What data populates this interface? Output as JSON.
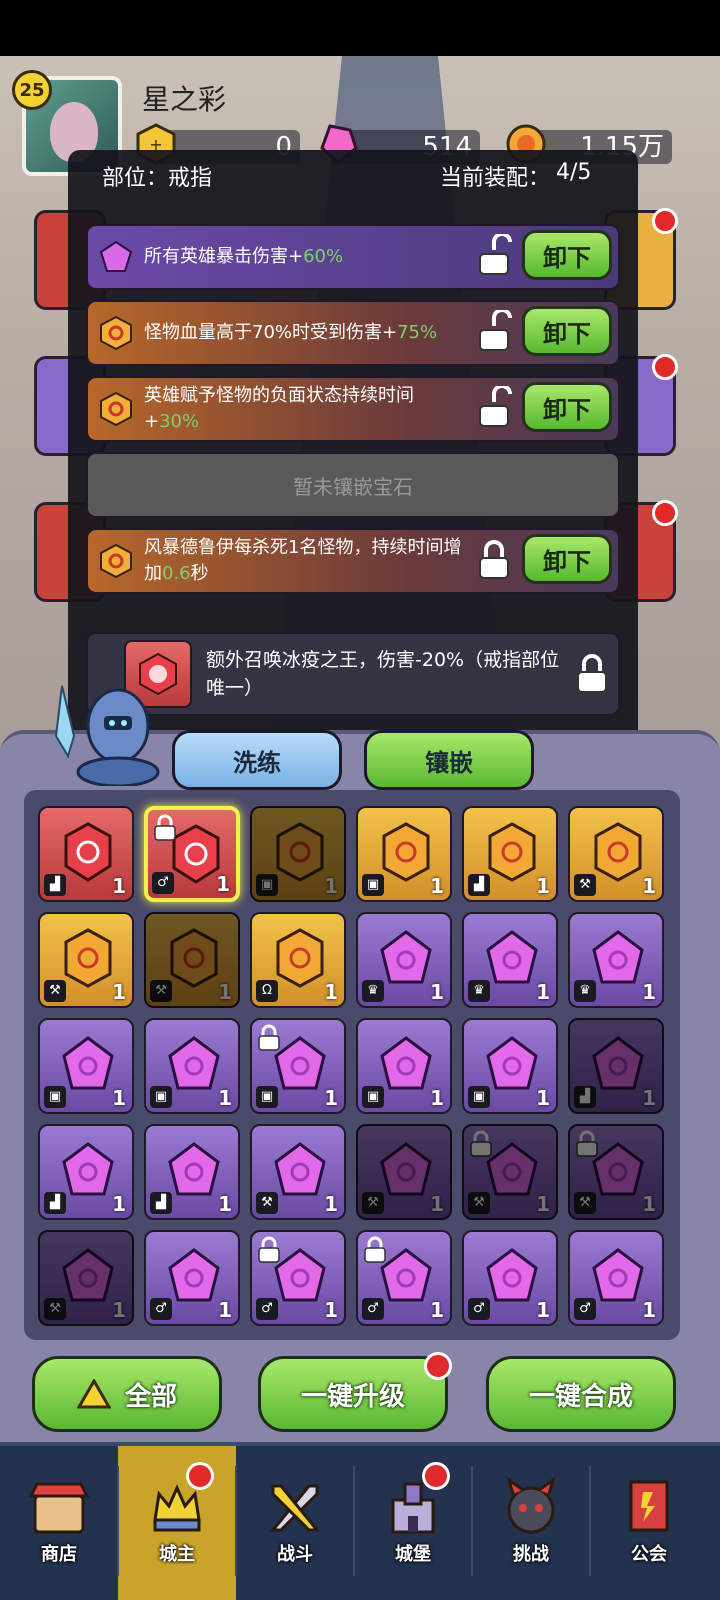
{
  "player": {
    "level": "25",
    "name": "星之彩"
  },
  "currencies": [
    {
      "name": "gold-coin-icon",
      "value": "0"
    },
    {
      "name": "pink-gem-icon",
      "value": "514"
    },
    {
      "name": "gold-medal-icon",
      "value": "1.15万"
    }
  ],
  "panel": {
    "slot_label": "部位：戒指",
    "equip_label": "当前装配：",
    "equip_count": "4/5",
    "rows": [
      {
        "type": "purple",
        "text": "所有英雄暴击伤害+",
        "value": "60%",
        "suffix": "",
        "button": "卸下",
        "locked": false
      },
      {
        "type": "orange",
        "text": "怪物血量高于70%时受到伤害+",
        "value": "75%",
        "suffix": "",
        "button": "卸下",
        "locked": false
      },
      {
        "type": "orange",
        "text": "英雄赋予怪物的负面状态持续时间+",
        "value": "30%",
        "suffix": "",
        "button": "卸下",
        "locked": false
      },
      {
        "type": "empty",
        "text": "暂未镶嵌宝石"
      },
      {
        "type": "orange",
        "text": "风暴德鲁伊每杀死1名怪物，持续时间增加",
        "value": "0.6",
        "suffix": "秒",
        "button": "卸下",
        "locked": true
      }
    ],
    "special": {
      "text": "额外召唤冰疫之王，伤害-20%（戒指部位唯一）"
    },
    "refine_button": "洗练",
    "inlay_button": "镶嵌"
  },
  "grid": {
    "cells": [
      {
        "color": "red",
        "part": "boot",
        "count": "1"
      },
      {
        "color": "red",
        "part": "ring",
        "count": "1",
        "selected": true,
        "locked": true
      },
      {
        "color": "gold",
        "part": "armor",
        "count": "1",
        "dim": true
      },
      {
        "color": "gold",
        "part": "armor",
        "count": "1"
      },
      {
        "color": "gold",
        "part": "boot",
        "count": "1"
      },
      {
        "color": "gold",
        "part": "weapon",
        "count": "1"
      },
      {
        "color": "gold",
        "part": "weapon",
        "count": "1"
      },
      {
        "color": "gold",
        "part": "weapon",
        "count": "1",
        "dim": true
      },
      {
        "color": "gold",
        "part": "necklace",
        "count": "1"
      },
      {
        "color": "purple",
        "part": "crown",
        "count": "1"
      },
      {
        "color": "purple",
        "part": "crown",
        "count": "1"
      },
      {
        "color": "purple",
        "part": "crown",
        "count": "1"
      },
      {
        "color": "purple",
        "part": "armor",
        "count": "1"
      },
      {
        "color": "purple",
        "part": "armor",
        "count": "1"
      },
      {
        "color": "purple",
        "part": "armor",
        "count": "1",
        "locked": true
      },
      {
        "color": "purple",
        "part": "armor",
        "count": "1"
      },
      {
        "color": "purple",
        "part": "armor",
        "count": "1"
      },
      {
        "color": "purple",
        "part": "boot",
        "count": "1",
        "dim": true
      },
      {
        "color": "purple",
        "part": "boot",
        "count": "1"
      },
      {
        "color": "purple",
        "part": "boot",
        "count": "1"
      },
      {
        "color": "purple",
        "part": "weapon",
        "count": "1"
      },
      {
        "color": "purple",
        "part": "weapon",
        "count": "1",
        "dim": true
      },
      {
        "color": "purple",
        "part": "weapon",
        "count": "1",
        "dim": true,
        "locked": true
      },
      {
        "color": "purple",
        "part": "weapon",
        "count": "1",
        "dim": true,
        "locked": true
      },
      {
        "color": "purple",
        "part": "weapon",
        "count": "1",
        "dim": true
      },
      {
        "color": "purple",
        "part": "ring",
        "count": "1"
      },
      {
        "color": "purple",
        "part": "ring",
        "count": "1",
        "locked": true
      },
      {
        "color": "purple",
        "part": "ring",
        "count": "1",
        "locked": true
      },
      {
        "color": "purple",
        "part": "ring",
        "count": "1"
      },
      {
        "color": "purple",
        "part": "ring",
        "count": "1"
      }
    ]
  },
  "actions": {
    "all": "全部",
    "upgrade": "一键升级",
    "merge": "一键合成"
  },
  "nav": [
    {
      "label": "商店",
      "icon": "shop-icon"
    },
    {
      "label": "城主",
      "icon": "lord-icon",
      "active": true,
      "badge": true
    },
    {
      "label": "战斗",
      "icon": "battle-swords-icon"
    },
    {
      "label": "城堡",
      "icon": "castle-icon",
      "badge": true
    },
    {
      "label": "挑战",
      "icon": "challenge-demon-icon"
    },
    {
      "label": "公会",
      "icon": "guild-banner-icon"
    }
  ],
  "colors": {
    "accent_green": "#7fd06a",
    "badge_red": "#e02a2a",
    "nav_active": "#c8a42a"
  }
}
